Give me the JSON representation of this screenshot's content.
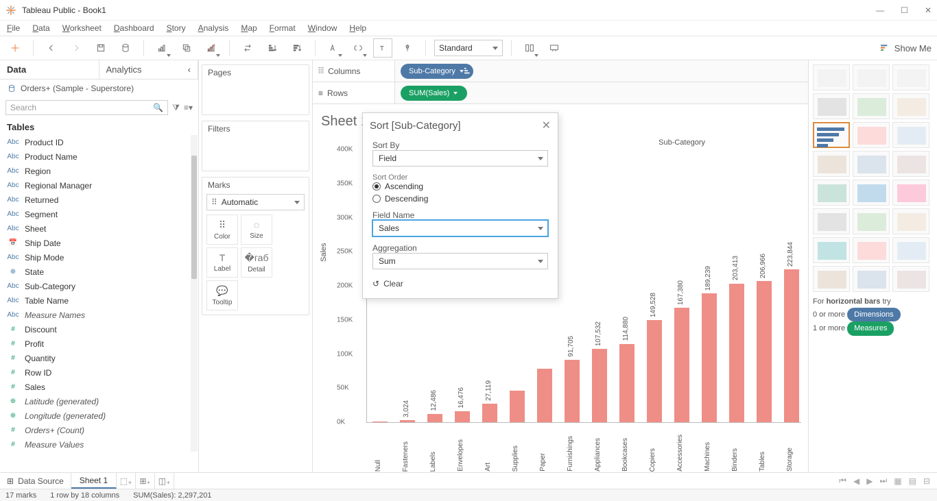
{
  "window": {
    "title": "Tableau Public - Book1"
  },
  "menu": [
    "File",
    "Data",
    "Worksheet",
    "Dashboard",
    "Story",
    "Analysis",
    "Map",
    "Format",
    "Window",
    "Help"
  ],
  "toolbar": {
    "fit": "Standard",
    "showme": "Show Me"
  },
  "sidebar": {
    "tabs": {
      "data": "Data",
      "analytics": "Analytics"
    },
    "datasource": "Orders+ (Sample - Superstore)",
    "search_placeholder": "Search",
    "tables_label": "Tables",
    "fields": [
      {
        "icon": "Abc",
        "kind": "dim",
        "name": "Product ID"
      },
      {
        "icon": "Abc",
        "kind": "dim",
        "name": "Product Name"
      },
      {
        "icon": "Abc",
        "kind": "dim",
        "name": "Region"
      },
      {
        "icon": "Abc",
        "kind": "dim",
        "name": "Regional Manager"
      },
      {
        "icon": "Abc",
        "kind": "dim",
        "name": "Returned"
      },
      {
        "icon": "Abc",
        "kind": "dim",
        "name": "Segment"
      },
      {
        "icon": "Abc",
        "kind": "dim",
        "name": "Sheet"
      },
      {
        "icon": "📅",
        "kind": "dim",
        "name": "Ship Date"
      },
      {
        "icon": "Abc",
        "kind": "dim",
        "name": "Ship Mode"
      },
      {
        "icon": "⊕",
        "kind": "dim",
        "name": "State"
      },
      {
        "icon": "Abc",
        "kind": "dim",
        "name": "Sub-Category"
      },
      {
        "icon": "Abc",
        "kind": "dim",
        "name": "Table Name"
      },
      {
        "icon": "Abc",
        "kind": "dim",
        "name": "Measure Names",
        "ital": true
      },
      {
        "icon": "#",
        "kind": "meas",
        "name": "Discount"
      },
      {
        "icon": "#",
        "kind": "meas",
        "name": "Profit"
      },
      {
        "icon": "#",
        "kind": "meas",
        "name": "Quantity"
      },
      {
        "icon": "#",
        "kind": "meas",
        "name": "Row ID"
      },
      {
        "icon": "#",
        "kind": "meas",
        "name": "Sales"
      },
      {
        "icon": "⊕",
        "kind": "meas",
        "name": "Latitude (generated)",
        "ital": true
      },
      {
        "icon": "⊕",
        "kind": "meas",
        "name": "Longitude (generated)",
        "ital": true
      },
      {
        "icon": "#",
        "kind": "meas",
        "name": "Orders+ (Count)",
        "ital": true
      },
      {
        "icon": "#",
        "kind": "meas",
        "name": "Measure Values",
        "ital": true
      }
    ]
  },
  "cards": {
    "pages": "Pages",
    "filters": "Filters",
    "marks": "Marks",
    "mark_type": "Automatic",
    "mark_buttons": [
      "Color",
      "Size",
      "Label",
      "Detail",
      "Tooltip"
    ]
  },
  "shelves": {
    "columns_label": "Columns",
    "rows_label": "Rows",
    "columns_pill": "Sub-Category",
    "rows_pill": "SUM(Sales)"
  },
  "viz": {
    "sheet_title": "Sheet 1",
    "x_header": "Sub-Category",
    "y_label": "Sales"
  },
  "chart_data": {
    "type": "bar",
    "title": "",
    "xlabel": "Sub-Category",
    "ylabel": "Sales",
    "ylim": [
      0,
      400000
    ],
    "yticks": [
      "0K",
      "50K",
      "100K",
      "150K",
      "200K",
      "250K",
      "300K",
      "350K",
      "400K"
    ],
    "categories": [
      "Null",
      "Fasteners",
      "Labels",
      "Envelopes",
      "Art",
      "Supplies",
      "Paper",
      "Furnishings",
      "Appliances",
      "Bookcases",
      "Copiers",
      "Accessories",
      "Machines",
      "Binders",
      "Tables",
      "Storage"
    ],
    "values": [
      1000,
      3024,
      12486,
      16476,
      27119,
      46000,
      78000,
      91705,
      107532,
      114880,
      149528,
      167380,
      189239,
      203413,
      206966,
      223844
    ],
    "value_labels": [
      "",
      "3,024",
      "12,486",
      "16,476",
      "27,119",
      "",
      "",
      "91,705",
      "107,532",
      "114,880",
      "149,528",
      "167,380",
      "189,239",
      "203,413",
      "206,966",
      "223,844"
    ]
  },
  "dialog": {
    "title": "Sort [Sub-Category]",
    "sort_by_label": "Sort By",
    "sort_by_value": "Field",
    "sort_order_label": "Sort Order",
    "asc": "Ascending",
    "desc": "Descending",
    "field_name_label": "Field Name",
    "field_name_value": "Sales",
    "aggregation_label": "Aggregation",
    "aggregation_value": "Sum",
    "clear": "Clear"
  },
  "showme_panel": {
    "hint_prefix": "For ",
    "hint_bold": "horizontal bars",
    "hint_suffix": " try",
    "line_dim_prefix": "0 or more ",
    "chip_dim": "Dimensions",
    "line_meas_prefix": "1 or more ",
    "chip_meas": "Measures"
  },
  "bottom": {
    "datasource": "Data Source",
    "sheet_tab": "Sheet 1"
  },
  "status": {
    "marks": "17 marks",
    "layout": "1 row by 18 columns",
    "agg": "SUM(Sales): 2,297,201"
  }
}
